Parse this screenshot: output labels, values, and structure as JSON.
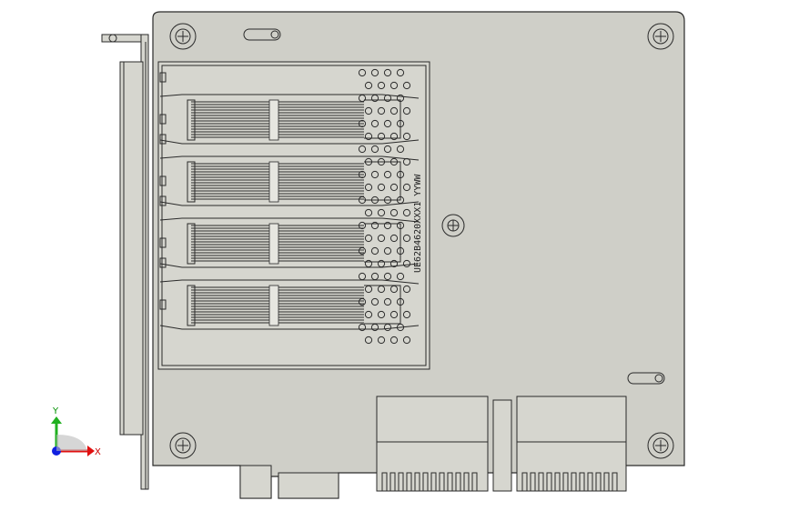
{
  "viewport": {
    "background": "#ffffff"
  },
  "board": {
    "part_marking": "UE62B4620XXX1 YYWW",
    "color_board": "#cfcfc8",
    "color_outline": "#2a2a2a"
  },
  "axis_triad": {
    "x_label": "X",
    "y_label": "Y",
    "x_color": "#e01010",
    "y_color": "#20b020",
    "z_color": "#1020e0"
  }
}
